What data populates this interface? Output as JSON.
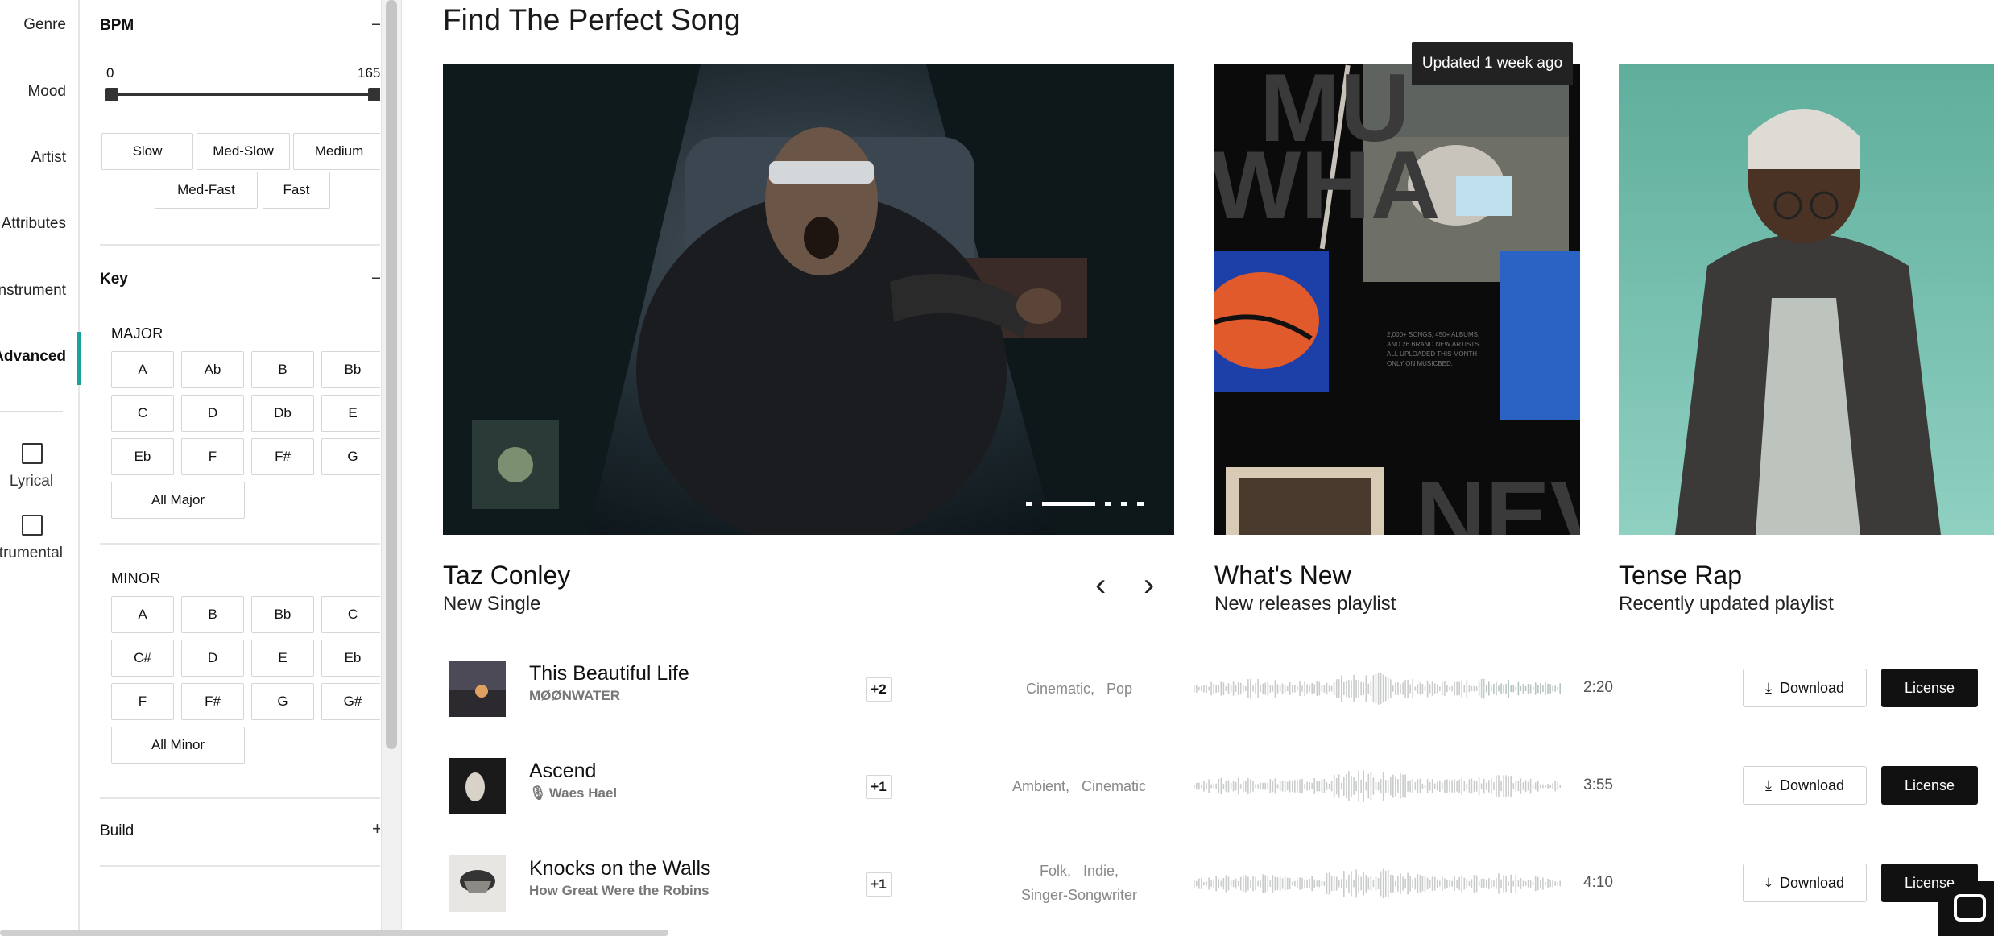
{
  "nav": {
    "items": [
      "Genre",
      "Mood",
      "Artist",
      "Attributes",
      "Instrument",
      "Advanced"
    ],
    "active": "Advanced",
    "checkboxes": [
      "Lyrical",
      "Instrumental"
    ]
  },
  "filters": {
    "bpm": {
      "title": "BPM",
      "toggle": "–",
      "min_label": "0",
      "max_label": "165",
      "tempos": [
        "Slow",
        "Med-Slow",
        "Medium",
        "Med-Fast",
        "Fast"
      ]
    },
    "key": {
      "title": "Key",
      "toggle": "–",
      "major_label": "MAJOR",
      "major": [
        "A",
        "Ab",
        "B",
        "Bb",
        "C",
        "D",
        "Db",
        "E",
        "Eb",
        "F",
        "F#",
        "G"
      ],
      "all_major": "All Major",
      "minor_label": "MINOR",
      "minor": [
        "A",
        "B",
        "Bb",
        "C",
        "C#",
        "D",
        "E",
        "Eb",
        "F",
        "F#",
        "G",
        "G#"
      ],
      "all_minor": "All Minor"
    },
    "build": {
      "title": "Build",
      "toggle": "+"
    }
  },
  "main": {
    "title": "Find The Perfect Song",
    "badge": "Updated 1 week ago",
    "cards": [
      {
        "name": "Taz Conley",
        "sub": "New Single"
      },
      {
        "name": "What's New",
        "sub": "New releases playlist"
      },
      {
        "name": "Tense Rap",
        "sub": "Recently updated playlist"
      }
    ],
    "promo_text": {
      "top": "MU",
      "mid": "WHA",
      "bottom": "NEV",
      "blurb": "2,000+ SONGS, 450+ ALBUMS, AND 26 BRAND NEW ARTISTS ALL UPLOADED THIS MONTH – ONLY ON MUSICBED."
    },
    "tracks": [
      {
        "title": "This Beautiful Life",
        "artist": "MØØNWATER",
        "more": "+2",
        "tags": [
          "Cinematic,",
          "Pop"
        ],
        "duration": "2:20"
      },
      {
        "title": "Ascend",
        "artist": "Waes Hael",
        "more": "+1",
        "tags": [
          "Ambient,",
          "Cinematic"
        ],
        "duration": "3:55"
      },
      {
        "title": "Knocks on the Walls",
        "artist": "How Great Were the Robins",
        "more": "+1",
        "tags": [
          "Folk,",
          "Indie,",
          "Singer-Songwriter"
        ],
        "duration": "4:10"
      }
    ],
    "download_label": "Download",
    "license_label": "License"
  },
  "colors": {
    "accent": "#1aa0a0",
    "dark": "#111111",
    "teal_bg": "#6bb5a3"
  },
  "icons": [
    "chevron-left-icon",
    "chevron-right-icon",
    "download-icon",
    "mic-off-icon",
    "chat-icon"
  ]
}
